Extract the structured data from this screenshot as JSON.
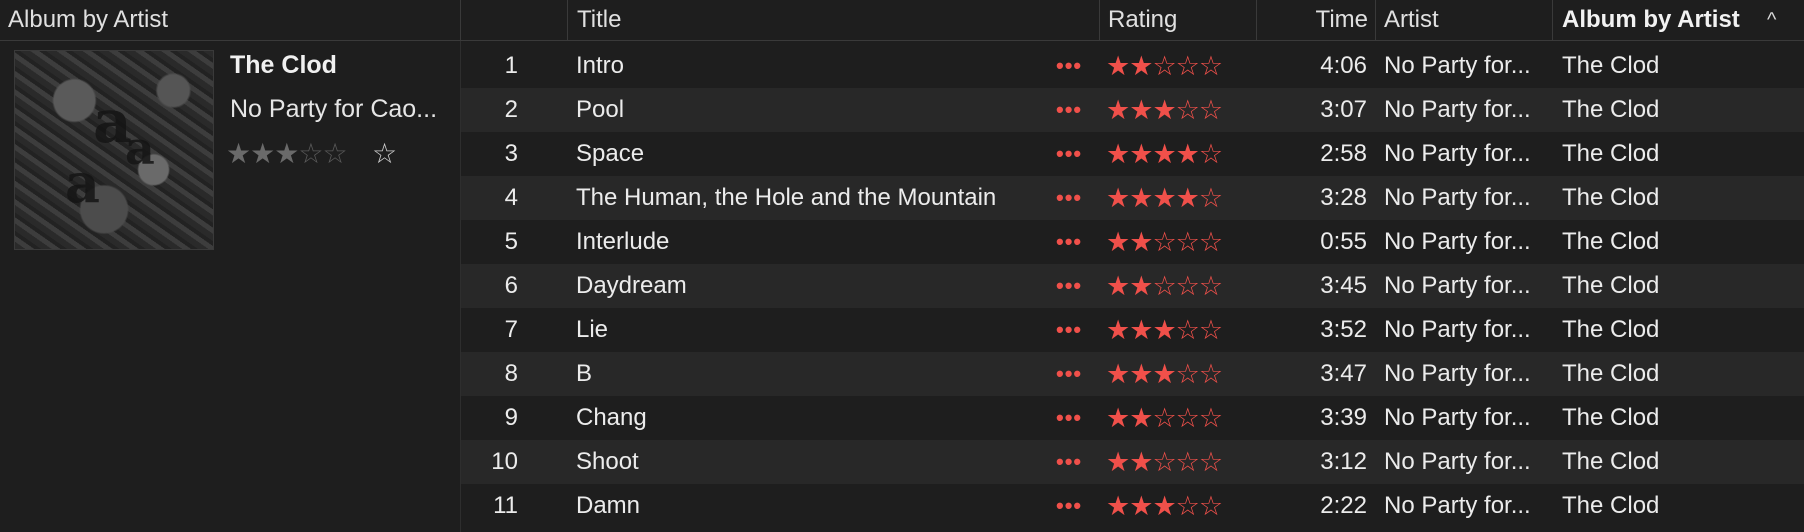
{
  "header": {
    "group_column": "Album by Artist",
    "title_column": "Title",
    "rating_column": "Rating",
    "time_column": "Time",
    "artist_column": "Artist",
    "album_column": "Album by Artist",
    "sort_indicator": "^"
  },
  "album": {
    "title": "The Clod",
    "artist": "No Party for Cao...",
    "rating_stars": 3,
    "rating_max": 5,
    "love_icon": "star-outline-icon",
    "artwork_icon": "album-artwork"
  },
  "colors": {
    "accent": "#f0504a",
    "background": "#1e1e1e",
    "row_alt": "#282828",
    "text": "#ececec"
  },
  "tracks": [
    {
      "number": "1",
      "title": "Intro",
      "more": "•••",
      "rating": 2,
      "time": "4:06",
      "artist": "No Party for...",
      "album": "The Clod"
    },
    {
      "number": "2",
      "title": "Pool",
      "more": "•••",
      "rating": 3,
      "time": "3:07",
      "artist": "No Party for...",
      "album": "The Clod"
    },
    {
      "number": "3",
      "title": "Space",
      "more": "•••",
      "rating": 4,
      "time": "2:58",
      "artist": "No Party for...",
      "album": "The Clod"
    },
    {
      "number": "4",
      "title": "The Human, the Hole and the Mountain",
      "more": "•••",
      "rating": 4,
      "time": "3:28",
      "artist": "No Party for...",
      "album": "The Clod"
    },
    {
      "number": "5",
      "title": "Interlude",
      "more": "•••",
      "rating": 2,
      "time": "0:55",
      "artist": "No Party for...",
      "album": "The Clod"
    },
    {
      "number": "6",
      "title": "Daydream",
      "more": "•••",
      "rating": 2,
      "time": "3:45",
      "artist": "No Party for...",
      "album": "The Clod"
    },
    {
      "number": "7",
      "title": "Lie",
      "more": "•••",
      "rating": 3,
      "time": "3:52",
      "artist": "No Party for...",
      "album": "The Clod"
    },
    {
      "number": "8",
      "title": "B",
      "more": "•••",
      "rating": 3,
      "time": "3:47",
      "artist": "No Party for...",
      "album": "The Clod"
    },
    {
      "number": "9",
      "title": "Chang",
      "more": "•••",
      "rating": 2,
      "time": "3:39",
      "artist": "No Party for...",
      "album": "The Clod"
    },
    {
      "number": "10",
      "title": "Shoot",
      "more": "•••",
      "rating": 2,
      "time": "3:12",
      "artist": "No Party for...",
      "album": "The Clod"
    },
    {
      "number": "11",
      "title": "Damn",
      "more": "•••",
      "rating": 3,
      "time": "2:22",
      "artist": "No Party for...",
      "album": "The Clod"
    }
  ]
}
